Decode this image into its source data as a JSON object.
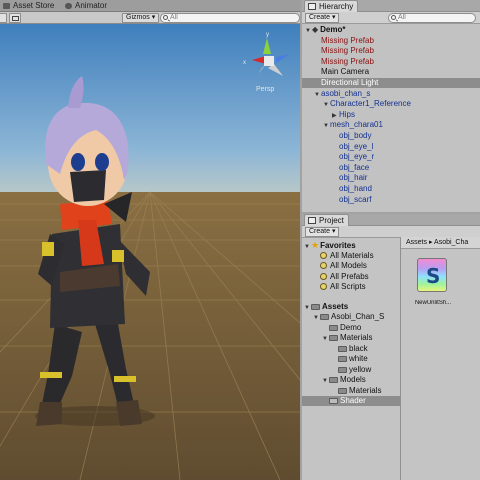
{
  "scene": {
    "tabs": [
      "Asset Store",
      "Animator"
    ],
    "gizmos_label": "Gizmos",
    "search_placeholder": "All",
    "perspective_label": "Persp",
    "colors": {
      "ground": "#6b5a3c",
      "sky": "#4a87c0",
      "grid": "#8a7a5a"
    }
  },
  "hierarchy": {
    "tab_label": "Hierarchy",
    "create_label": "Create",
    "search_placeholder": "All",
    "items": [
      {
        "label": "Demo*",
        "depth": 0,
        "expanded": true,
        "style": "dark"
      },
      {
        "label": "Missing Prefab",
        "depth": 1,
        "style": "miss"
      },
      {
        "label": "Missing Prefab",
        "depth": 1,
        "style": "miss"
      },
      {
        "label": "Missing Prefab",
        "depth": 1,
        "style": "miss"
      },
      {
        "label": "Main Camera",
        "depth": 1,
        "style": "dark"
      },
      {
        "label": "Directional Light",
        "depth": 1,
        "style": "dark",
        "selected": true
      },
      {
        "label": "asobi_chan_s",
        "depth": 1,
        "expanded": true,
        "style": "blue"
      },
      {
        "label": "Character1_Reference",
        "depth": 2,
        "expanded": true,
        "style": "blue"
      },
      {
        "label": "Hips",
        "depth": 3,
        "expanded": false,
        "style": "blue"
      },
      {
        "label": "mesh_chara01",
        "depth": 2,
        "expanded": true,
        "style": "blue"
      },
      {
        "label": "obj_body",
        "depth": 3,
        "style": "blue"
      },
      {
        "label": "obj_eye_l",
        "depth": 3,
        "style": "blue"
      },
      {
        "label": "obj_eye_r",
        "depth": 3,
        "style": "blue"
      },
      {
        "label": "obj_face",
        "depth": 3,
        "style": "blue"
      },
      {
        "label": "obj_hair",
        "depth": 3,
        "style": "blue"
      },
      {
        "label": "obj_hand",
        "depth": 3,
        "style": "blue"
      },
      {
        "label": "obj_scarf",
        "depth": 3,
        "style": "blue"
      }
    ]
  },
  "project": {
    "tab_label": "Project",
    "create_label": "Create",
    "breadcrumb": "Assets ▸ Asobi_Cha",
    "favorites_label": "Favorites",
    "favorites": [
      "All Materials",
      "All Models",
      "All Prefabs",
      "All Scripts"
    ],
    "assets_label": "Assets",
    "tree": [
      {
        "label": "Asobi_Chan_S",
        "depth": 1,
        "expanded": true
      },
      {
        "label": "Demo",
        "depth": 2
      },
      {
        "label": "Materials",
        "depth": 2,
        "expanded": true
      },
      {
        "label": "black",
        "depth": 3
      },
      {
        "label": "white",
        "depth": 3
      },
      {
        "label": "yellow",
        "depth": 3
      },
      {
        "label": "Models",
        "depth": 2,
        "expanded": true
      },
      {
        "label": "Materials",
        "depth": 3
      },
      {
        "label": "Shader",
        "depth": 2,
        "selected": true
      }
    ],
    "asset_icon_letter": "S",
    "asset_name": "NewUnlitSh..."
  }
}
